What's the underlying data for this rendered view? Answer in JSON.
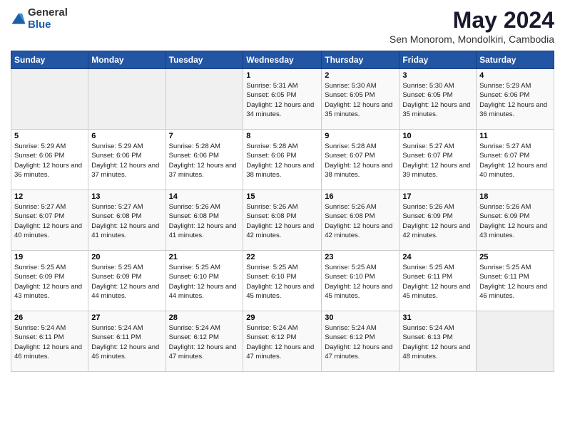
{
  "logo": {
    "general": "General",
    "blue": "Blue"
  },
  "title": {
    "month_year": "May 2024",
    "location": "Sen Monorom, Mondolkiri, Cambodia"
  },
  "weekdays": [
    "Sunday",
    "Monday",
    "Tuesday",
    "Wednesday",
    "Thursday",
    "Friday",
    "Saturday"
  ],
  "weeks": [
    [
      {
        "day": "",
        "sunrise": "",
        "sunset": "",
        "daylight": "",
        "empty": true
      },
      {
        "day": "",
        "sunrise": "",
        "sunset": "",
        "daylight": "",
        "empty": true
      },
      {
        "day": "",
        "sunrise": "",
        "sunset": "",
        "daylight": "",
        "empty": true
      },
      {
        "day": "1",
        "sunrise": "Sunrise: 5:31 AM",
        "sunset": "Sunset: 6:05 PM",
        "daylight": "Daylight: 12 hours and 34 minutes."
      },
      {
        "day": "2",
        "sunrise": "Sunrise: 5:30 AM",
        "sunset": "Sunset: 6:05 PM",
        "daylight": "Daylight: 12 hours and 35 minutes."
      },
      {
        "day": "3",
        "sunrise": "Sunrise: 5:30 AM",
        "sunset": "Sunset: 6:05 PM",
        "daylight": "Daylight: 12 hours and 35 minutes."
      },
      {
        "day": "4",
        "sunrise": "Sunrise: 5:29 AM",
        "sunset": "Sunset: 6:06 PM",
        "daylight": "Daylight: 12 hours and 36 minutes."
      }
    ],
    [
      {
        "day": "5",
        "sunrise": "Sunrise: 5:29 AM",
        "sunset": "Sunset: 6:06 PM",
        "daylight": "Daylight: 12 hours and 36 minutes."
      },
      {
        "day": "6",
        "sunrise": "Sunrise: 5:29 AM",
        "sunset": "Sunset: 6:06 PM",
        "daylight": "Daylight: 12 hours and 37 minutes."
      },
      {
        "day": "7",
        "sunrise": "Sunrise: 5:28 AM",
        "sunset": "Sunset: 6:06 PM",
        "daylight": "Daylight: 12 hours and 37 minutes."
      },
      {
        "day": "8",
        "sunrise": "Sunrise: 5:28 AM",
        "sunset": "Sunset: 6:06 PM",
        "daylight": "Daylight: 12 hours and 38 minutes."
      },
      {
        "day": "9",
        "sunrise": "Sunrise: 5:28 AM",
        "sunset": "Sunset: 6:07 PM",
        "daylight": "Daylight: 12 hours and 38 minutes."
      },
      {
        "day": "10",
        "sunrise": "Sunrise: 5:27 AM",
        "sunset": "Sunset: 6:07 PM",
        "daylight": "Daylight: 12 hours and 39 minutes."
      },
      {
        "day": "11",
        "sunrise": "Sunrise: 5:27 AM",
        "sunset": "Sunset: 6:07 PM",
        "daylight": "Daylight: 12 hours and 40 minutes."
      }
    ],
    [
      {
        "day": "12",
        "sunrise": "Sunrise: 5:27 AM",
        "sunset": "Sunset: 6:07 PM",
        "daylight": "Daylight: 12 hours and 40 minutes."
      },
      {
        "day": "13",
        "sunrise": "Sunrise: 5:27 AM",
        "sunset": "Sunset: 6:08 PM",
        "daylight": "Daylight: 12 hours and 41 minutes."
      },
      {
        "day": "14",
        "sunrise": "Sunrise: 5:26 AM",
        "sunset": "Sunset: 6:08 PM",
        "daylight": "Daylight: 12 hours and 41 minutes."
      },
      {
        "day": "15",
        "sunrise": "Sunrise: 5:26 AM",
        "sunset": "Sunset: 6:08 PM",
        "daylight": "Daylight: 12 hours and 42 minutes."
      },
      {
        "day": "16",
        "sunrise": "Sunrise: 5:26 AM",
        "sunset": "Sunset: 6:08 PM",
        "daylight": "Daylight: 12 hours and 42 minutes."
      },
      {
        "day": "17",
        "sunrise": "Sunrise: 5:26 AM",
        "sunset": "Sunset: 6:09 PM",
        "daylight": "Daylight: 12 hours and 42 minutes."
      },
      {
        "day": "18",
        "sunrise": "Sunrise: 5:26 AM",
        "sunset": "Sunset: 6:09 PM",
        "daylight": "Daylight: 12 hours and 43 minutes."
      }
    ],
    [
      {
        "day": "19",
        "sunrise": "Sunrise: 5:25 AM",
        "sunset": "Sunset: 6:09 PM",
        "daylight": "Daylight: 12 hours and 43 minutes."
      },
      {
        "day": "20",
        "sunrise": "Sunrise: 5:25 AM",
        "sunset": "Sunset: 6:09 PM",
        "daylight": "Daylight: 12 hours and 44 minutes."
      },
      {
        "day": "21",
        "sunrise": "Sunrise: 5:25 AM",
        "sunset": "Sunset: 6:10 PM",
        "daylight": "Daylight: 12 hours and 44 minutes."
      },
      {
        "day": "22",
        "sunrise": "Sunrise: 5:25 AM",
        "sunset": "Sunset: 6:10 PM",
        "daylight": "Daylight: 12 hours and 45 minutes."
      },
      {
        "day": "23",
        "sunrise": "Sunrise: 5:25 AM",
        "sunset": "Sunset: 6:10 PM",
        "daylight": "Daylight: 12 hours and 45 minutes."
      },
      {
        "day": "24",
        "sunrise": "Sunrise: 5:25 AM",
        "sunset": "Sunset: 6:11 PM",
        "daylight": "Daylight: 12 hours and 45 minutes."
      },
      {
        "day": "25",
        "sunrise": "Sunrise: 5:25 AM",
        "sunset": "Sunset: 6:11 PM",
        "daylight": "Daylight: 12 hours and 46 minutes."
      }
    ],
    [
      {
        "day": "26",
        "sunrise": "Sunrise: 5:24 AM",
        "sunset": "Sunset: 6:11 PM",
        "daylight": "Daylight: 12 hours and 46 minutes."
      },
      {
        "day": "27",
        "sunrise": "Sunrise: 5:24 AM",
        "sunset": "Sunset: 6:11 PM",
        "daylight": "Daylight: 12 hours and 46 minutes."
      },
      {
        "day": "28",
        "sunrise": "Sunrise: 5:24 AM",
        "sunset": "Sunset: 6:12 PM",
        "daylight": "Daylight: 12 hours and 47 minutes."
      },
      {
        "day": "29",
        "sunrise": "Sunrise: 5:24 AM",
        "sunset": "Sunset: 6:12 PM",
        "daylight": "Daylight: 12 hours and 47 minutes."
      },
      {
        "day": "30",
        "sunrise": "Sunrise: 5:24 AM",
        "sunset": "Sunset: 6:12 PM",
        "daylight": "Daylight: 12 hours and 47 minutes."
      },
      {
        "day": "31",
        "sunrise": "Sunrise: 5:24 AM",
        "sunset": "Sunset: 6:13 PM",
        "daylight": "Daylight: 12 hours and 48 minutes."
      },
      {
        "day": "",
        "sunrise": "",
        "sunset": "",
        "daylight": "",
        "empty": true
      }
    ]
  ]
}
